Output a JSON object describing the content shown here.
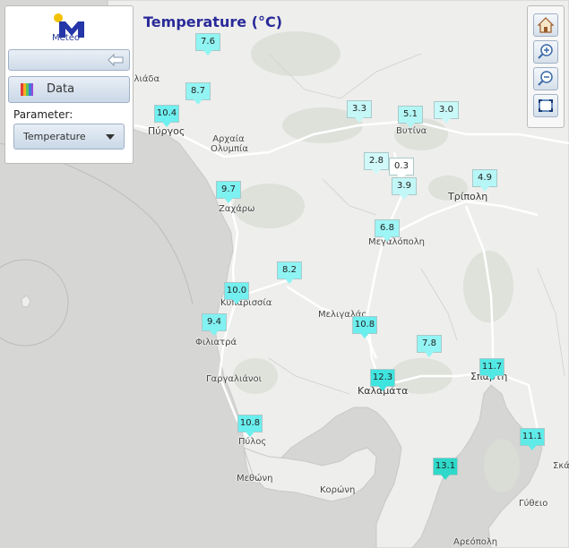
{
  "map": {
    "title": "Temperature (°C)",
    "places": [
      {
        "name": "Ηλιάδα",
        "big": false
      },
      {
        "name": "Πύργος",
        "big": true
      },
      {
        "name": "Αρχαία Ολυμπία",
        "big": false
      },
      {
        "name": "Βυτίνα",
        "big": false
      },
      {
        "name": "Τρίπολη",
        "big": true
      },
      {
        "name": "Ζαχάρω",
        "big": false
      },
      {
        "name": "Μεγαλόπολη",
        "big": false
      },
      {
        "name": "Κυπαρισσία",
        "big": false
      },
      {
        "name": "Μελιγαλάς",
        "big": false
      },
      {
        "name": "Φιλιατρά",
        "big": false
      },
      {
        "name": "Γαργαλιάνοι",
        "big": false
      },
      {
        "name": "Καλαμάτα",
        "big": true
      },
      {
        "name": "Σπάρτη",
        "big": true
      },
      {
        "name": "Πύλος",
        "big": false
      },
      {
        "name": "Μεθώνη",
        "big": false
      },
      {
        "name": "Κορώνη",
        "big": false
      },
      {
        "name": "Σκά",
        "big": false
      },
      {
        "name": "Γύθειο",
        "big": false
      },
      {
        "name": "Αρεόπολη",
        "big": false
      }
    ],
    "stations": [
      {
        "value": "7.6",
        "color": "#8ff4f2"
      },
      {
        "value": "8.7",
        "color": "#93f5f3"
      },
      {
        "value": "10.4",
        "color": "#6fefef"
      },
      {
        "value": "3.3",
        "color": "#c6f7f7"
      },
      {
        "value": "5.1",
        "color": "#b3f5f5"
      },
      {
        "value": "3.0",
        "color": "#c9f8f8"
      },
      {
        "value": "2.8",
        "color": "#d2f9f9"
      },
      {
        "value": "0.3",
        "color": "#ffffff"
      },
      {
        "value": "3.9",
        "color": "#c3f7f7"
      },
      {
        "value": "4.9",
        "color": "#b6f6f6"
      },
      {
        "value": "9.7",
        "color": "#7ef1f1"
      },
      {
        "value": "6.8",
        "color": "#9ef5f5"
      },
      {
        "value": "8.2",
        "color": "#8ff3f3"
      },
      {
        "value": "10.0",
        "color": "#73efef"
      },
      {
        "value": "9.4",
        "color": "#82f1f1"
      },
      {
        "value": "10.8",
        "color": "#6beeee"
      },
      {
        "value": "7.8",
        "color": "#93f4f4"
      },
      {
        "value": "12.3",
        "color": "#3fe4df"
      },
      {
        "value": "11.7",
        "color": "#52e8e4"
      },
      {
        "value": "10.8",
        "color": "#6beeee"
      },
      {
        "value": "11.1",
        "color": "#60ebe8"
      },
      {
        "value": "13.1",
        "color": "#2ed9c9"
      }
    ]
  },
  "panel": {
    "logo_text": "Meteo",
    "data_label": "Data",
    "parameter_label": "Parameter:",
    "parameter_value": "Temperature"
  },
  "toolbar": {
    "tools": [
      "home-icon",
      "zoom-in-icon",
      "zoom-out-icon",
      "zoom-extent-icon"
    ]
  }
}
